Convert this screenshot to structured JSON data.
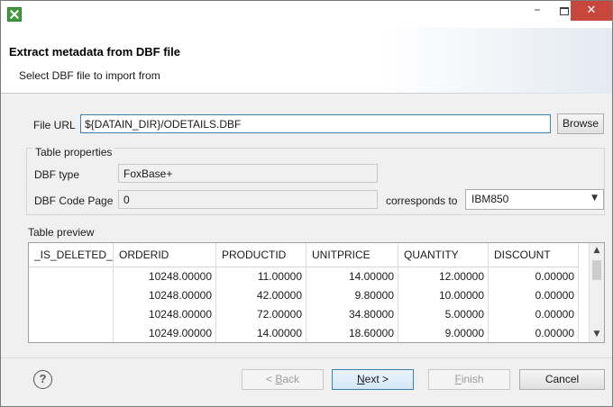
{
  "titlebar": {
    "minimize": "–",
    "close": "✕"
  },
  "header": {
    "title": "Extract metadata from DBF file",
    "subtitle": "Select DBF file to import from"
  },
  "file_url": {
    "label": "File URL",
    "value": "${DATAIN_DIR}/ODETAILS.DBF",
    "browse": "Browse"
  },
  "table_properties": {
    "title": "Table properties",
    "dbf_type_label": "DBF type",
    "dbf_type_value": "FoxBase+",
    "code_page_label": "DBF Code Page",
    "code_page_value": "0",
    "corresponds_label": "corresponds to",
    "corresponds_value": "IBM850"
  },
  "preview": {
    "title": "Table preview",
    "columns": [
      "_IS_DELETED_",
      "ORDERID",
      "PRODUCTID",
      "UNITPRICE",
      "QUANTITY",
      "DISCOUNT"
    ],
    "rows": [
      [
        "",
        "10248.00000",
        "11.00000",
        "14.00000",
        "12.00000",
        "0.00000"
      ],
      [
        "",
        "10248.00000",
        "42.00000",
        "9.80000",
        "10.00000",
        "0.00000"
      ],
      [
        "",
        "10248.00000",
        "72.00000",
        "34.80000",
        "5.00000",
        "0.00000"
      ],
      [
        "",
        "10249.00000",
        "14.00000",
        "18.60000",
        "9.00000",
        "0.00000"
      ]
    ]
  },
  "footer": {
    "help": "?",
    "back": {
      "prefix": "< ",
      "mnemonic": "B",
      "rest": "ack"
    },
    "next": {
      "mnemonic": "N",
      "rest": "ext >"
    },
    "finish": {
      "mnemonic": "F",
      "rest": "inish"
    },
    "cancel": "Cancel"
  },
  "icons": {
    "app": "clover-app-icon",
    "help": "help-icon"
  }
}
